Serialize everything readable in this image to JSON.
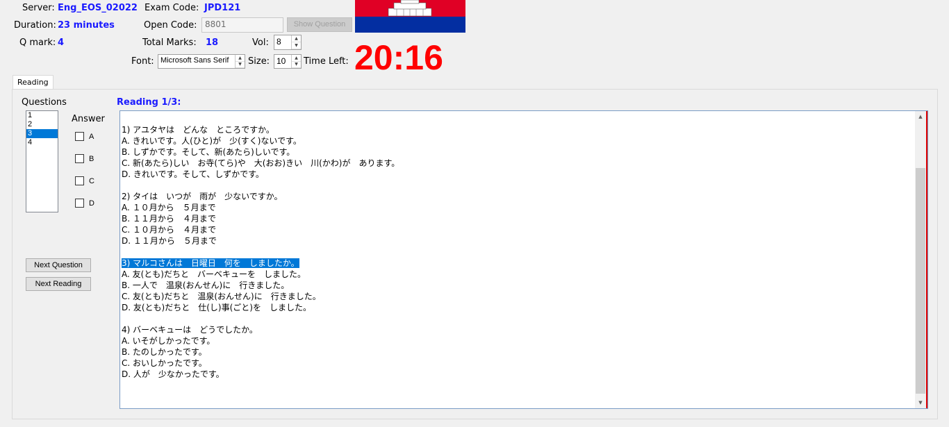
{
  "header": {
    "server_label": "Server:",
    "server_value": "Eng_EOS_02022",
    "duration_label": "Duration:",
    "duration_value": "23 minutes",
    "qmark_label": "Q mark:",
    "qmark_value": "4",
    "exam_code_label": "Exam Code:",
    "exam_code_value": "JPD121",
    "open_code_label": "Open Code:",
    "open_code_value": "8801",
    "show_question_button": "Show Question",
    "total_marks_label": "Total Marks:",
    "total_marks_value": "18",
    "vol_label": "Vol:",
    "vol_value": "8",
    "font_label": "Font:",
    "font_value": "Microsoft Sans Serif",
    "size_label": "Size:",
    "size_value": "10",
    "time_left_label": "Time Left:",
    "timer": "20:16"
  },
  "flag": {
    "icon": "cambodia-flag-icon",
    "colors": {
      "top": "#e00025",
      "bottom": "#032ea1"
    }
  },
  "tabs": [
    {
      "label": "Reading",
      "active": true
    }
  ],
  "left_panel": {
    "questions_label": "Questions",
    "questions": [
      "1",
      "2",
      "3",
      "4"
    ],
    "selected_question": "3",
    "answer_label": "Answer",
    "answers": [
      "A",
      "B",
      "C",
      "D"
    ],
    "next_question_button": "Next Question",
    "next_reading_button": "Next Reading"
  },
  "reading": {
    "title": "Reading 1/3:",
    "lines": [
      "",
      "1) アユタヤは　どんな　ところですか。",
      "A. きれいです。人(ひと)が　少(すく)ないです。",
      "B. しずかです。そして、新(あたら)しいです。",
      "C. 新(あたら)しい　お寺(てら)や　大(おお)きい　川(かわ)が　あります。",
      "D. きれいです。そして、しずかです。",
      "",
      "2) タイは　いつが　雨が　少ないですか。",
      "A. １０月から　５月まで",
      "B. １１月から　４月まで",
      "C. １０月から　４月まで",
      "D. １１月から　５月まで",
      "",
      "3) マルコさんは　日曜日　何を　しましたか。",
      "A. 友(とも)だちと　バーベキューを　しました。",
      "B. 一人で　温泉(おんせん)に　行きました。",
      "C. 友(とも)だちと　温泉(おんせん)に　行きました。",
      "D. 友(とも)だちと　仕(し)事(ごと)を　しました。",
      "",
      "4) バーベキューは　どうでしたか。",
      "A. いそがしかったです。",
      "B. たのしかったです。",
      "C. おいしかったです。",
      "D. 人が　少なかったです。"
    ],
    "highlighted_line": 13
  }
}
